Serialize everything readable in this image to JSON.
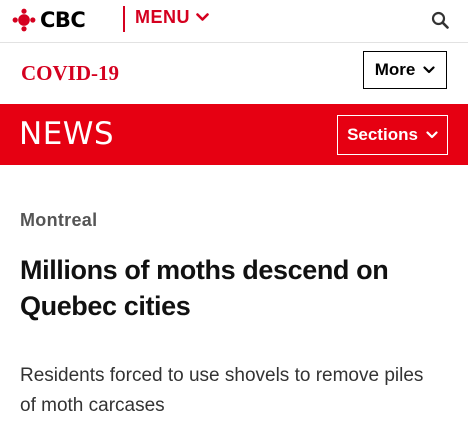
{
  "header": {
    "logo_text": "CBC",
    "menu_label": "MENU",
    "brand_color": "#d5001f",
    "icons": [
      "cbc-gem-icon",
      "chevron-down-icon",
      "search-icon"
    ]
  },
  "subnav": {
    "covid_label": "COVID-19",
    "more_label": "More"
  },
  "newsbar": {
    "title": "NEWS",
    "sections_label": "Sections",
    "background": "#e60012"
  },
  "article": {
    "section": "Montreal",
    "headline": "Millions of moths descend on Quebec cities",
    "deck": "Residents forced to use shovels to remove piles of moth carcases"
  }
}
